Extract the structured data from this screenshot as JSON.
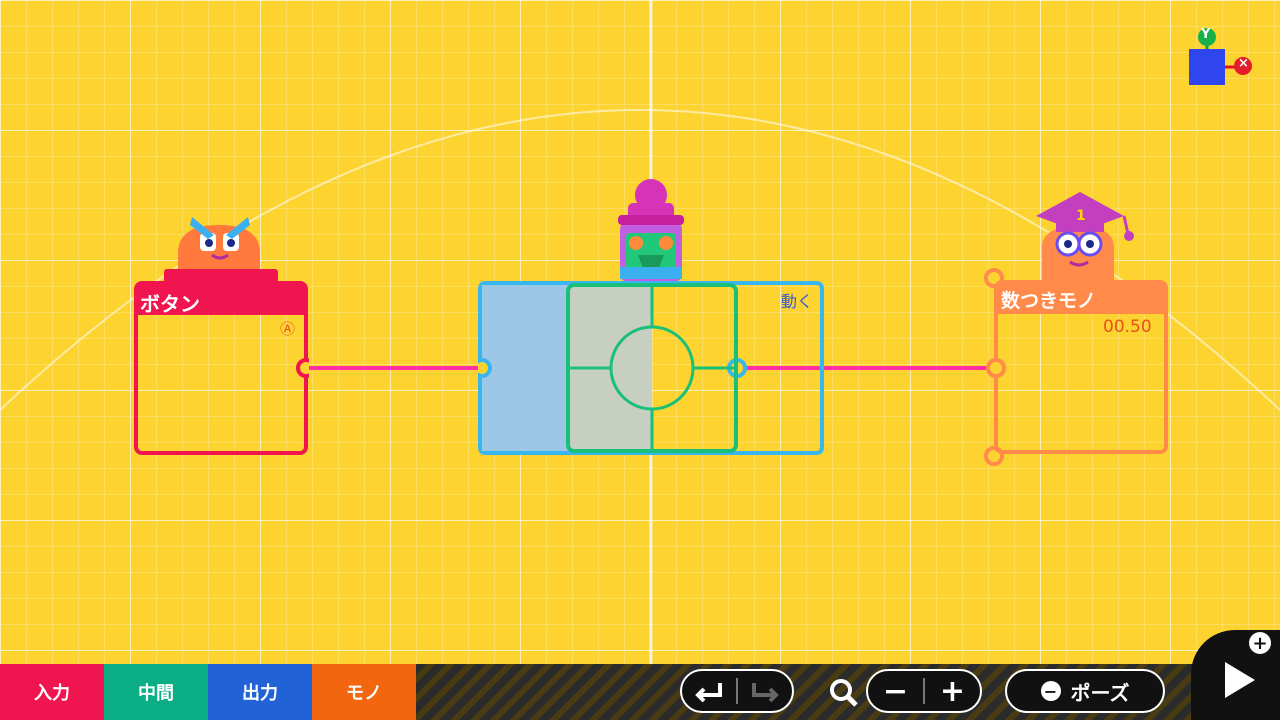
{
  "nodes": {
    "button": {
      "title": "ボタン",
      "badge": "Ⓐ"
    },
    "move": {
      "title": "動く"
    },
    "counter": {
      "title": "数つきモノ",
      "value": "00.50"
    }
  },
  "axis_gizmo": {
    "y_label": "Y",
    "x_label": "×"
  },
  "categories": [
    {
      "label": "入力",
      "color": "#f0154f"
    },
    {
      "label": "中間",
      "color": "#0cae86"
    },
    {
      "label": "出力",
      "color": "#2162d6"
    },
    {
      "label": "モノ",
      "color": "#f2660f"
    }
  ],
  "controls": {
    "pause_label": "ポーズ",
    "minus_symbol": "−",
    "plus_symbol": "+"
  },
  "colors": {
    "background": "#fdd32f",
    "wire": "#ff2fa8",
    "button_node": "#f0154f",
    "move_node": "#38b6f0",
    "stick": "#18c07a",
    "counter_node": "#ff8a4a"
  }
}
